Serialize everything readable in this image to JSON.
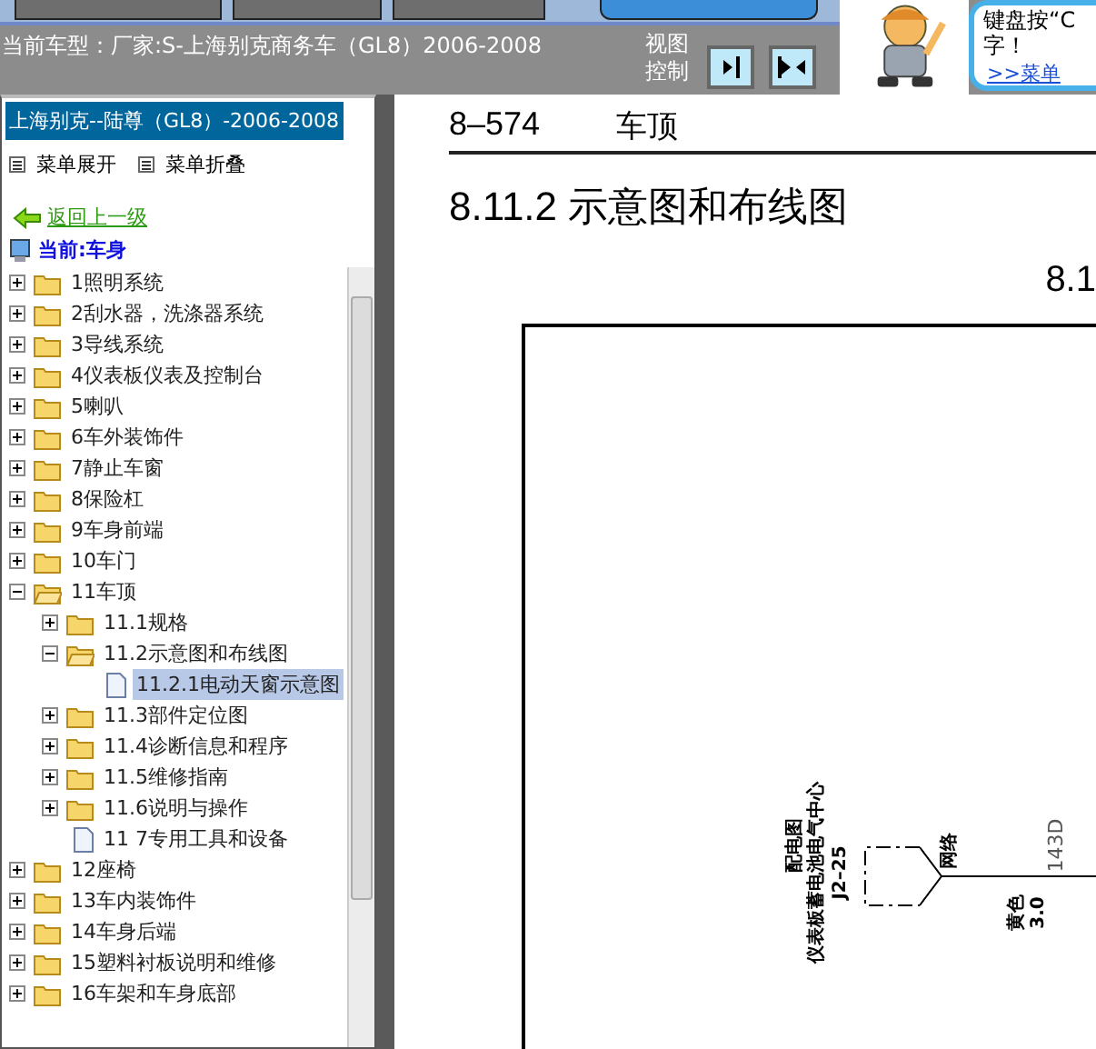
{
  "car_model": "当前车型：厂家:S-上海别克商务车（GL8）2006-2008",
  "view_control": {
    "label": "视图控制"
  },
  "tip": {
    "text": "键盘按“C",
    "text_2": "字！",
    "link": ">>菜单"
  },
  "sidebar": {
    "title": "上海别克--陆尊（GL8）-2006-2008",
    "expand_all": "菜单展开",
    "collapse_all": "菜单折叠",
    "back": "返回上一级",
    "current": "当前:车身",
    "tree": [
      {
        "label": "1照明系统",
        "kind": "folder",
        "expanded": false,
        "selected": false
      },
      {
        "label": "2刮水器，洗涤器系统",
        "kind": "folder",
        "expanded": false,
        "selected": false
      },
      {
        "label": "3导线系统",
        "kind": "folder",
        "expanded": false,
        "selected": false
      },
      {
        "label": "4仪表板仪表及控制台",
        "kind": "folder",
        "expanded": false,
        "selected": false
      },
      {
        "label": "5喇叭",
        "kind": "folder",
        "expanded": false,
        "selected": false
      },
      {
        "label": "6车外装饰件",
        "kind": "folder",
        "expanded": false,
        "selected": false
      },
      {
        "label": "7静止车窗",
        "kind": "folder",
        "expanded": false,
        "selected": false
      },
      {
        "label": "8保险杠",
        "kind": "folder",
        "expanded": false,
        "selected": false
      },
      {
        "label": "9车身前端",
        "kind": "folder",
        "expanded": false,
        "selected": false
      },
      {
        "label": "10车门",
        "kind": "folder",
        "expanded": false,
        "selected": false
      },
      {
        "label": "11车顶",
        "kind": "folder",
        "expanded": true,
        "selected": false,
        "children": [
          {
            "label": "11.1规格",
            "kind": "folder",
            "expanded": false,
            "selected": false
          },
          {
            "label": "11.2示意图和布线图",
            "kind": "folder",
            "expanded": true,
            "selected": false,
            "children": [
              {
                "label": "11.2.1电动天窗示意图",
                "kind": "page",
                "selected": true
              }
            ]
          },
          {
            "label": "11.3部件定位图",
            "kind": "folder",
            "expanded": false,
            "selected": false
          },
          {
            "label": "11.4诊断信息和程序",
            "kind": "folder",
            "expanded": false,
            "selected": false
          },
          {
            "label": "11.5维修指南",
            "kind": "folder",
            "expanded": false,
            "selected": false
          },
          {
            "label": "11.6说明与操作",
            "kind": "folder",
            "expanded": false,
            "selected": false
          },
          {
            "label": "11 7专用工具和设备",
            "kind": "page",
            "selected": false
          }
        ]
      },
      {
        "label": "12座椅",
        "kind": "folder",
        "expanded": false,
        "selected": false
      },
      {
        "label": "13车内装饰件",
        "kind": "folder",
        "expanded": false,
        "selected": false
      },
      {
        "label": "14车身后端",
        "kind": "folder",
        "expanded": false,
        "selected": false
      },
      {
        "label": "15塑料衬板说明和维修",
        "kind": "folder",
        "expanded": false,
        "selected": false
      },
      {
        "label": "16车架和车身底部",
        "kind": "folder",
        "expanded": false,
        "selected": false
      }
    ]
  },
  "document": {
    "page_number": "8–574",
    "section": "车顶",
    "heading": "8.11.2 示意图和布线图",
    "figure_number": "8.1",
    "diagram": {
      "component_title": "配电图",
      "component_name": "仪表板蓄电池电气中心",
      "connector": "J2–25",
      "pin_label": "网络",
      "wire_color": "黄色",
      "wire_size": "3.0",
      "circuit": "143D"
    }
  }
}
